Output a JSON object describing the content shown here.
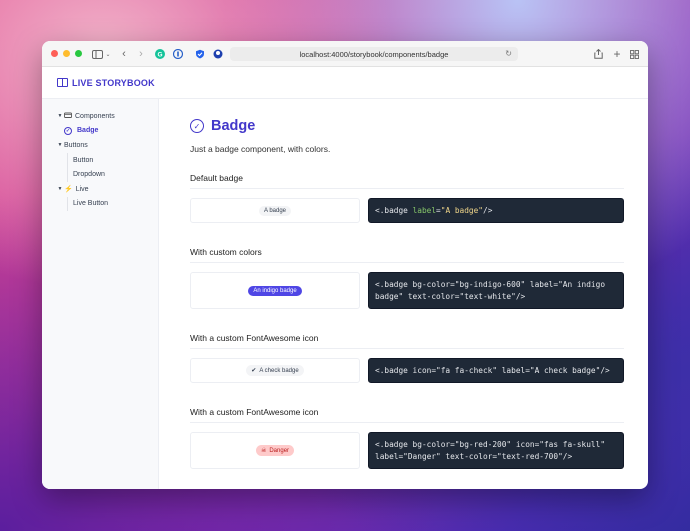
{
  "browser": {
    "url": "localhost:4000/storybook/components/badge",
    "light_colors": [
      "#fe5f57",
      "#febc2e",
      "#28c840"
    ]
  },
  "app": {
    "logo_text": "LIVE STORYBOOK"
  },
  "sidebar": {
    "items": [
      {
        "label": "Components",
        "caret": "▼",
        "icon": "🗂"
      },
      {
        "label": "Badge",
        "icon": "✓",
        "active": true
      },
      {
        "label": "Buttons",
        "caret": "▼"
      },
      {
        "label": "Button"
      },
      {
        "label": "Dropdown"
      },
      {
        "label": "Live",
        "caret": "▼",
        "icon": "⚡"
      },
      {
        "label": "Live Button"
      }
    ]
  },
  "page": {
    "title": "Badge",
    "subtitle": "Just a badge component, with colors."
  },
  "sections": [
    {
      "heading": "Default badge",
      "badge_label": "A badge",
      "code": [
        [
          "<.badge ",
          ""
        ],
        [
          "label=",
          "\"A badge\""
        ],
        [
          "/>",
          ""
        ]
      ]
    },
    {
      "heading": "With custom colors",
      "badge_label": "An indigo badge",
      "code_line1": "<.badge bg-color=\"bg-indigo-600\" label=\"An indigo",
      "code_line2": "badge\" text-color=\"text-white\"/>"
    },
    {
      "heading": "With a custom FontAwesome icon",
      "badge_label": "A check badge",
      "badge_icon": "✔",
      "code_line1": "<.badge icon=\"fa fa-check\" label=\"A check badge\"/>"
    },
    {
      "heading": "With a custom FontAwesome icon",
      "badge_label": "Danger",
      "badge_icon": "☠",
      "code_line1": "<.badge bg-color=\"bg-red-200\" icon=\"fas fa-skull\"",
      "code_line2": "label=\"Danger\" text-color=\"text-red-700\"/>"
    }
  ],
  "colors": {
    "accent": "#4338ca",
    "code_bg": "#1f2937",
    "indigo_badge": "#4f46e5",
    "danger_badge_bg": "#fecaca",
    "danger_badge_text": "#b91c1c"
  }
}
